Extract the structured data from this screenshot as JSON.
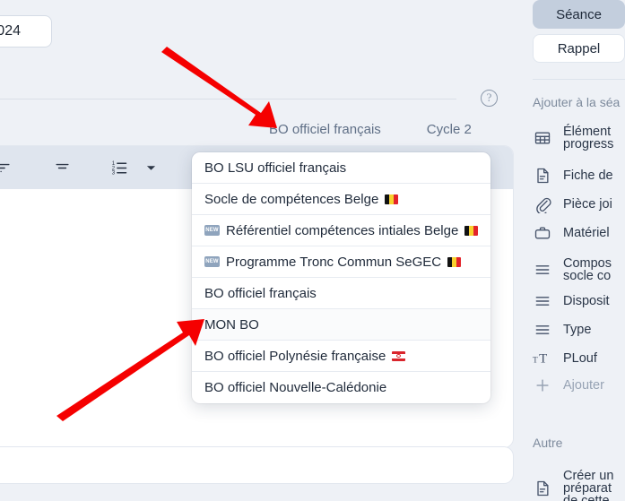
{
  "background_color": "#eef1f6",
  "accent_arrow_color": "#f50000",
  "main": {
    "year_field": {
      "value": "024",
      "placeholder": ""
    },
    "help_icon_glyph": "?",
    "context_tabs": [
      {
        "label": "BO officiel français"
      },
      {
        "label": "Cycle 2"
      }
    ],
    "toolbar": {
      "buttons": [
        {
          "name": "align-left-icon",
          "label": ""
        },
        {
          "name": "align-center-icon",
          "label": ""
        },
        {
          "name": "numbered-list-icon",
          "label": ""
        },
        {
          "name": "chevron-down-icon",
          "label": ""
        },
        {
          "name": "pilcrow-icon",
          "label": ""
        },
        {
          "name": "insert-block-icon",
          "label": ""
        }
      ]
    }
  },
  "dropdown": {
    "name": "bo-referential-dropdown",
    "items": [
      {
        "label": "BO LSU officiel français",
        "badge": "",
        "flag": "",
        "highlighted": false
      },
      {
        "label": "Socle de compétences Belge",
        "badge": "",
        "flag": "be",
        "highlighted": false
      },
      {
        "label": "Référentiel compétences intiales Belge",
        "badge": "NEW",
        "flag": "be",
        "highlighted": false
      },
      {
        "label": "Programme Tronc Commun SeGEC",
        "badge": "NEW",
        "flag": "be",
        "highlighted": false
      },
      {
        "label": "BO officiel français",
        "badge": "",
        "flag": "",
        "highlighted": false
      },
      {
        "label": "MON BO",
        "badge": "",
        "flag": "",
        "highlighted": true
      },
      {
        "label": "BO officiel Polynésie française",
        "badge": "",
        "flag": "pf",
        "highlighted": false
      },
      {
        "label": "BO officiel Nouvelle-Calédonie",
        "badge": "",
        "flag": "",
        "highlighted": false
      }
    ]
  },
  "sidebar": {
    "tabs": [
      {
        "label": "Séance",
        "active": true
      },
      {
        "label": "Rappel",
        "active": false
      }
    ],
    "section_add_label": "Ajouter à la séa",
    "add_items": [
      {
        "icon": "table-icon",
        "line1": "Élément",
        "line2": "progress"
      },
      {
        "icon": "document-icon",
        "line1": "Fiche de",
        "line2": ""
      },
      {
        "icon": "paperclip-icon",
        "line1": "Pièce joi",
        "line2": ""
      },
      {
        "icon": "briefcase-icon",
        "line1": "Matériel",
        "line2": ""
      },
      {
        "icon": "list-lines-icon",
        "line1": "Compos",
        "line2": "socle co"
      },
      {
        "icon": "list-lines-icon",
        "line1": "Disposit",
        "line2": ""
      },
      {
        "icon": "list-lines-icon",
        "line1": "Type",
        "line2": ""
      },
      {
        "icon": "text-format-icon",
        "line1": "PLouf",
        "line2": ""
      },
      {
        "icon": "plus-icon",
        "line1": "Ajouter",
        "line2": ""
      }
    ],
    "section_other_label": "Autre",
    "other_items": [
      {
        "icon": "document-icon",
        "line1": "Créer un",
        "line2": "préparat",
        "line3": "de cette"
      }
    ]
  }
}
